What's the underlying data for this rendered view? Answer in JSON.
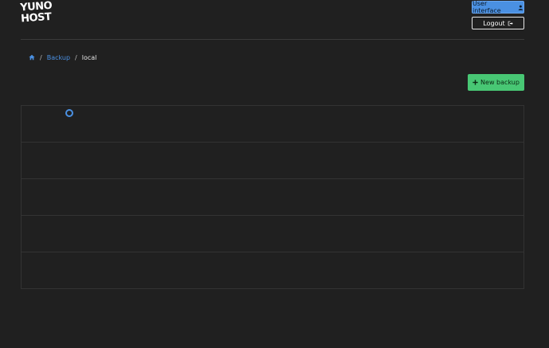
{
  "logo": {
    "line1": "YUNO",
    "line2": "HOST"
  },
  "header": {
    "user_interface_label": "User interface",
    "logout_label": "Logout"
  },
  "breadcrumb": {
    "home_icon": "home-icon",
    "items": [
      "Backup",
      "local"
    ],
    "separator": "/"
  },
  "actions": {
    "new_backup_label": "New backup"
  },
  "colors": {
    "background": "#202020",
    "primary": "#4a90e2",
    "success": "#48c774"
  }
}
